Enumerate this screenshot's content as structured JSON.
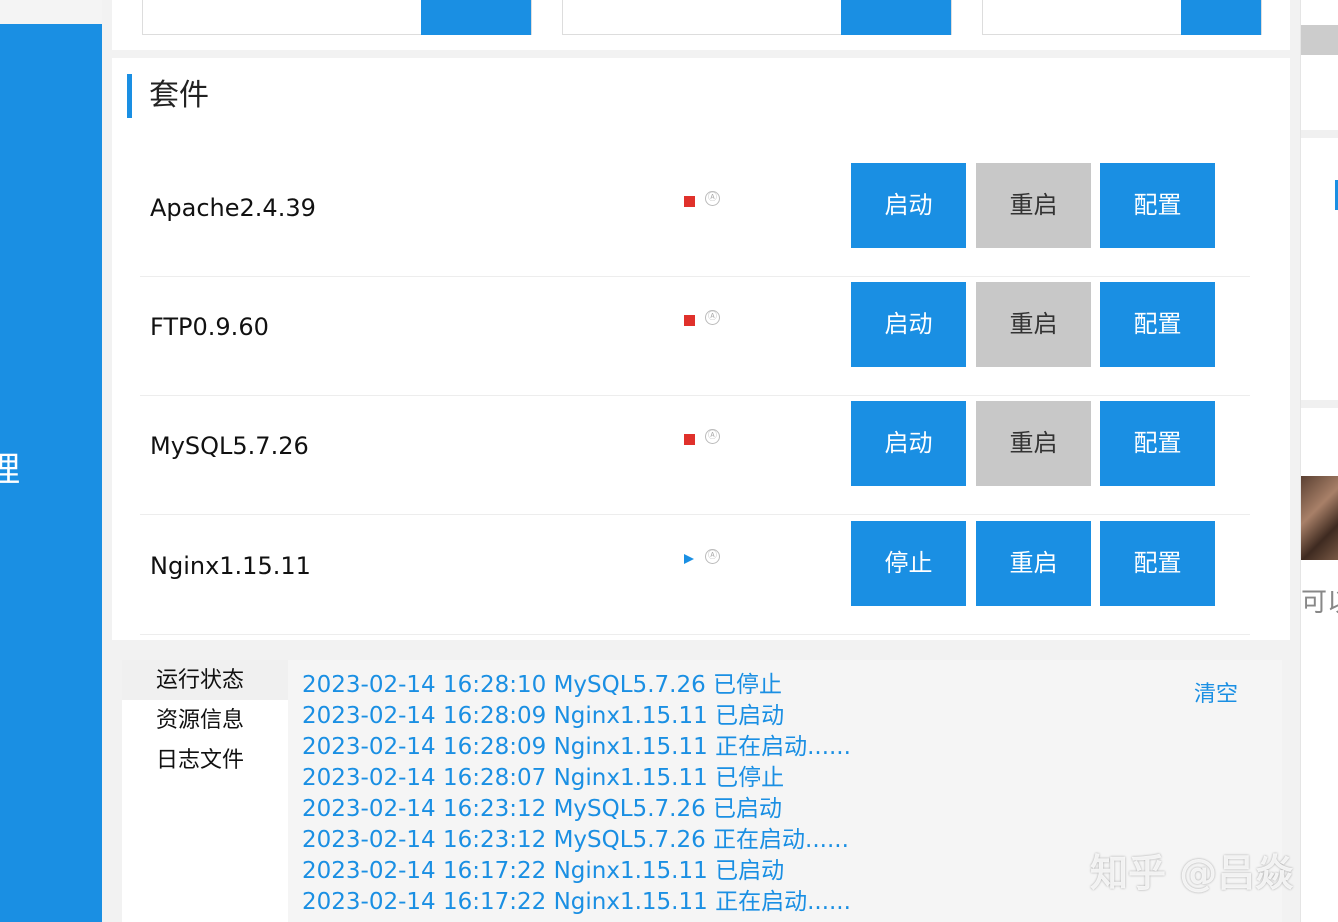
{
  "sidebar": {
    "partial_char": "理"
  },
  "suite": {
    "title": "套件",
    "items": [
      {
        "name": "Apache2.4.39",
        "status": "stopped",
        "auto_icon": "Ⓐ",
        "action_label": "启动",
        "restart_label": "重启",
        "config_label": "配置",
        "restart_enabled": false
      },
      {
        "name": "FTP0.9.60",
        "status": "stopped",
        "auto_icon": "Ⓐ",
        "action_label": "启动",
        "restart_label": "重启",
        "config_label": "配置",
        "restart_enabled": false
      },
      {
        "name": "MySQL5.7.26",
        "status": "stopped",
        "auto_icon": "Ⓐ",
        "action_label": "启动",
        "restart_label": "重启",
        "config_label": "配置",
        "restart_enabled": false
      },
      {
        "name": "Nginx1.15.11",
        "status": "running",
        "auto_icon": "Ⓐ",
        "action_label": "停止",
        "restart_label": "重启",
        "config_label": "配置",
        "restart_enabled": true
      }
    ]
  },
  "log_panel": {
    "tabs": [
      "运行状态",
      "资源信息",
      "日志文件"
    ],
    "active_tab": 0,
    "clear_label": "清空",
    "entries": [
      "2023-02-14 16:28:10 MySQL5.7.26 已停止",
      "2023-02-14 16:28:09 Nginx1.15.11 已启动",
      "2023-02-14 16:28:09 Nginx1.15.11 正在启动......",
      "2023-02-14 16:28:07 Nginx1.15.11 已停止",
      "2023-02-14 16:23:12 MySQL5.7.26 已启动",
      "2023-02-14 16:23:12 MySQL5.7.26 正在启动......",
      "2023-02-14 16:17:22 Nginx1.15.11 已启动",
      "2023-02-14 16:17:22 Nginx1.15.11 正在启动......"
    ]
  },
  "right_panel": {
    "partial_text": "可以"
  },
  "watermark": "知乎 @吕焱",
  "colors": {
    "accent": "#1a8fe3",
    "stopped": "#e0312b",
    "disabled": "#c8c8c8"
  }
}
